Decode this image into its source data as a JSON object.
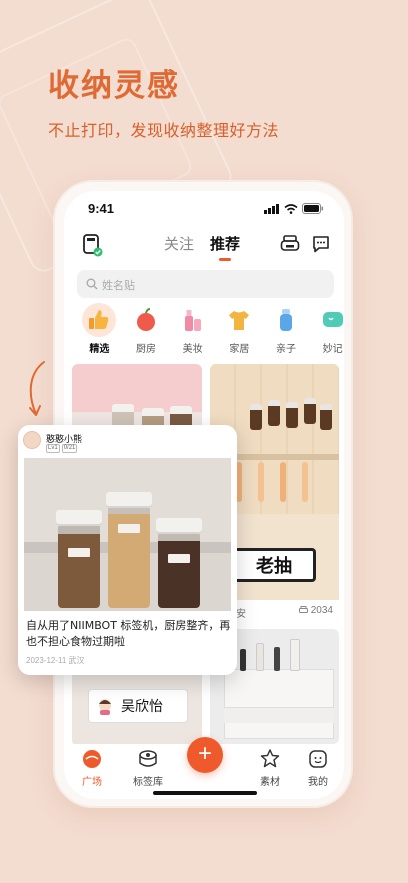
{
  "promo": {
    "headline": "收纳灵感",
    "subline": "不止打印，发现收纳整理好方法"
  },
  "status_bar": {
    "time": "9:41"
  },
  "top_nav": {
    "tabs": [
      {
        "label": "关注",
        "active": false
      },
      {
        "label": "推荐",
        "active": true
      }
    ]
  },
  "search": {
    "placeholder": "姓名贴"
  },
  "categories": [
    {
      "label": "精选",
      "active": true,
      "icon": "thumbs-up-icon",
      "color": "#f7a53a"
    },
    {
      "label": "厨房",
      "active": false,
      "icon": "apple-icon",
      "color": "#ef5a4b"
    },
    {
      "label": "美妆",
      "active": false,
      "icon": "cosmetics-icon",
      "color": "#f08aa6"
    },
    {
      "label": "家居",
      "active": false,
      "icon": "shirt-icon",
      "color": "#f2b540"
    },
    {
      "label": "亲子",
      "active": false,
      "icon": "bottle-icon",
      "color": "#5aa7e8"
    },
    {
      "label": "妙记",
      "active": false,
      "icon": "chat-icon",
      "color": "#4fcbb6"
    }
  ],
  "feed": {
    "card_b": {
      "label_text": "老抽",
      "author_fragment": "月早安",
      "count": "2034"
    },
    "card_d": {
      "label_text": "吴欣怡"
    }
  },
  "popup": {
    "username": "憨憨小熊",
    "badges": [
      "Lv1",
      "0/21"
    ],
    "description": "自从用了NIIMBOT 标签机，厨房整齐，再也不担心食物过期啦",
    "date_location": "2023-12-11 武汉"
  },
  "tab_bar": {
    "items": [
      {
        "label": "广场",
        "active": true
      },
      {
        "label": "标签库",
        "active": false
      },
      {
        "label": "素材",
        "active": false
      },
      {
        "label": "我的",
        "active": false
      }
    ],
    "fab_symbol": "+"
  },
  "colors": {
    "accent": "#ef5a2c",
    "headline": "#e06a34",
    "background": "#f3dcd0"
  }
}
